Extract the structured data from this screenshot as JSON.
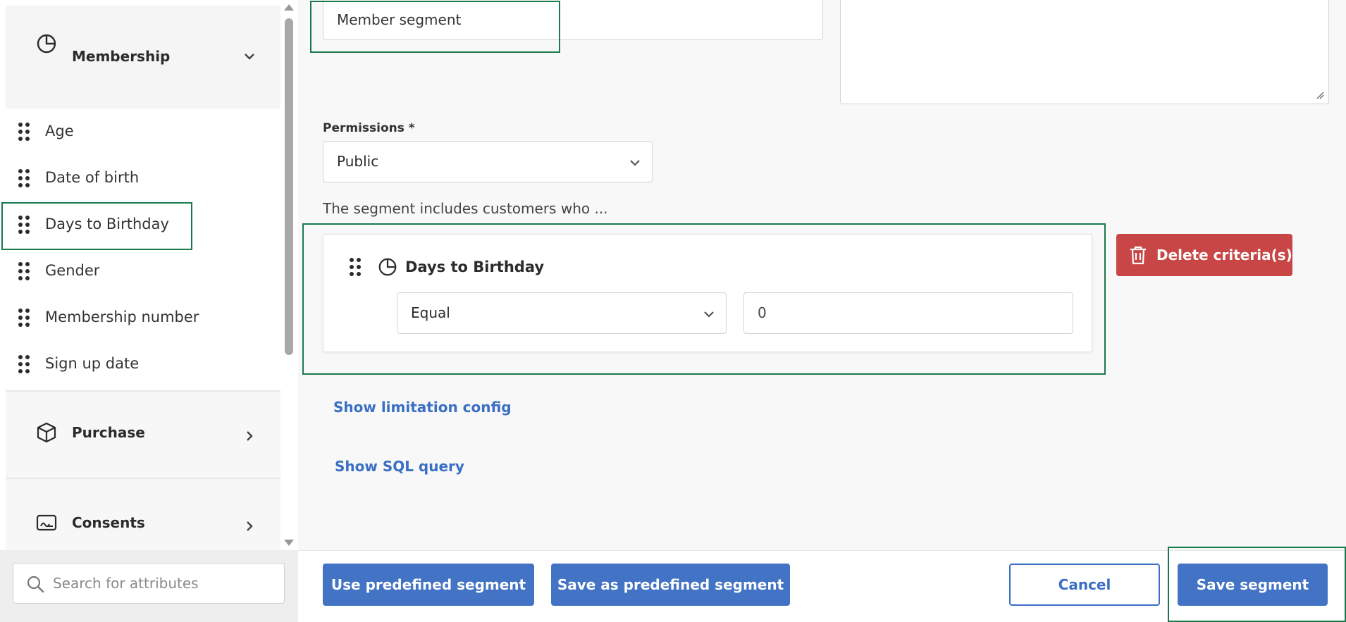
{
  "sidebar": {
    "groups": [
      {
        "label": "Membership",
        "icon": "pie-chart-icon",
        "expanded": true
      },
      {
        "label": "Purchase",
        "icon": "cube-icon",
        "expanded": false
      },
      {
        "label": "Consents",
        "icon": "consent-card-icon",
        "expanded": false
      }
    ],
    "attributes": [
      {
        "label": "Age"
      },
      {
        "label": "Date of birth"
      },
      {
        "label": "Days to Birthday",
        "selected": true
      },
      {
        "label": "Gender"
      },
      {
        "label": "Membership number"
      },
      {
        "label": "Sign up date"
      }
    ],
    "search": {
      "placeholder": "Search for attributes",
      "value": ""
    }
  },
  "form": {
    "segment_name": "Member segment",
    "description": "",
    "permissions_label": "Permissions *",
    "permissions_value": "Public",
    "includes_text": "The segment includes customers who ...",
    "criteria": {
      "title": "Days to Birthday",
      "operator": "Equal",
      "value": "0"
    },
    "delete_label": "Delete criteria(s)",
    "show_limitation": "Show limitation config",
    "show_sql": "Show SQL query"
  },
  "footer": {
    "use_predefined": "Use predefined segment",
    "save_as_predefined": "Save as predefined segment",
    "cancel": "Cancel",
    "save": "Save segment"
  },
  "colors": {
    "primary": "#4373c4",
    "danger": "#c84646",
    "highlight": "#1a7a4e"
  }
}
